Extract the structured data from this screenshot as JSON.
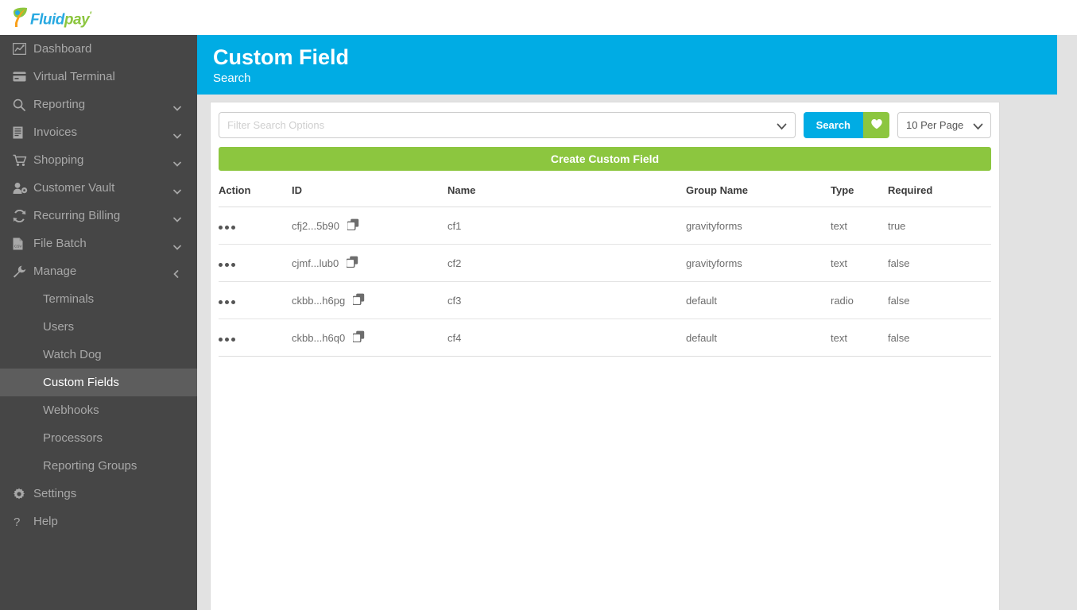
{
  "brand": {
    "logo_text_primary": "Fluid",
    "logo_text_secondary": "pay",
    "logo_tick": "'",
    "blue": "#00ace4",
    "green": "#8cc63f",
    "sidebar_bg": "#464646"
  },
  "sidebar": {
    "items": [
      {
        "label": "Dashboard",
        "icon": "chart-line-icon",
        "caret": "none"
      },
      {
        "label": "Virtual Terminal",
        "icon": "credit-card-icon",
        "caret": "none"
      },
      {
        "label": "Reporting",
        "icon": "search-icon",
        "caret": "down"
      },
      {
        "label": "Invoices",
        "icon": "invoice-icon",
        "caret": "down"
      },
      {
        "label": "Shopping",
        "icon": "cart-icon",
        "caret": "down"
      },
      {
        "label": "Customer Vault",
        "icon": "user-gear-icon",
        "caret": "down"
      },
      {
        "label": "Recurring Billing",
        "icon": "refresh-icon",
        "caret": "down"
      },
      {
        "label": "File Batch",
        "icon": "csv-file-icon",
        "caret": "down"
      },
      {
        "label": "Manage",
        "icon": "wrench-icon",
        "caret": "left"
      }
    ],
    "sub_items": [
      {
        "label": "Terminals",
        "active": false
      },
      {
        "label": "Users",
        "active": false
      },
      {
        "label": "Watch Dog",
        "active": false
      },
      {
        "label": "Custom Fields",
        "active": true
      },
      {
        "label": "Webhooks",
        "active": false
      },
      {
        "label": "Processors",
        "active": false
      },
      {
        "label": "Reporting Groups",
        "active": false
      }
    ],
    "footer_items": [
      {
        "label": "Settings",
        "icon": "gear-icon"
      },
      {
        "label": "Help",
        "icon": "question-mark-icon"
      }
    ]
  },
  "header": {
    "title": "Custom Field",
    "subtitle": "Search"
  },
  "toolbar": {
    "filter_placeholder": "Filter Search Options",
    "filter_value": "",
    "filter_caret_icon": "chevron-down-icon",
    "search_label": "Search",
    "favorite_icon": "heart-icon",
    "per_page_value": "10 Per Page",
    "per_page_caret_icon": "chevron-down-icon",
    "create_label": "Create Custom Field"
  },
  "table": {
    "columns": [
      "Action",
      "ID",
      "Name",
      "Group Name",
      "Type",
      "Required"
    ],
    "row_action_icon": "ellipsis-icon",
    "copy_icon": "copy-icon",
    "rows": [
      {
        "id": "cfj2...5b90",
        "name": "cf1",
        "group_name": "gravityforms",
        "type": "text",
        "required": "true"
      },
      {
        "id": "cjmf...lub0",
        "name": "cf2",
        "group_name": "gravityforms",
        "type": "text",
        "required": "false"
      },
      {
        "id": "ckbb...h6pg",
        "name": "cf3",
        "group_name": "default",
        "type": "radio",
        "required": "false"
      },
      {
        "id": "ckbb...h6q0",
        "name": "cf4",
        "group_name": "default",
        "type": "text",
        "required": "false"
      }
    ]
  }
}
